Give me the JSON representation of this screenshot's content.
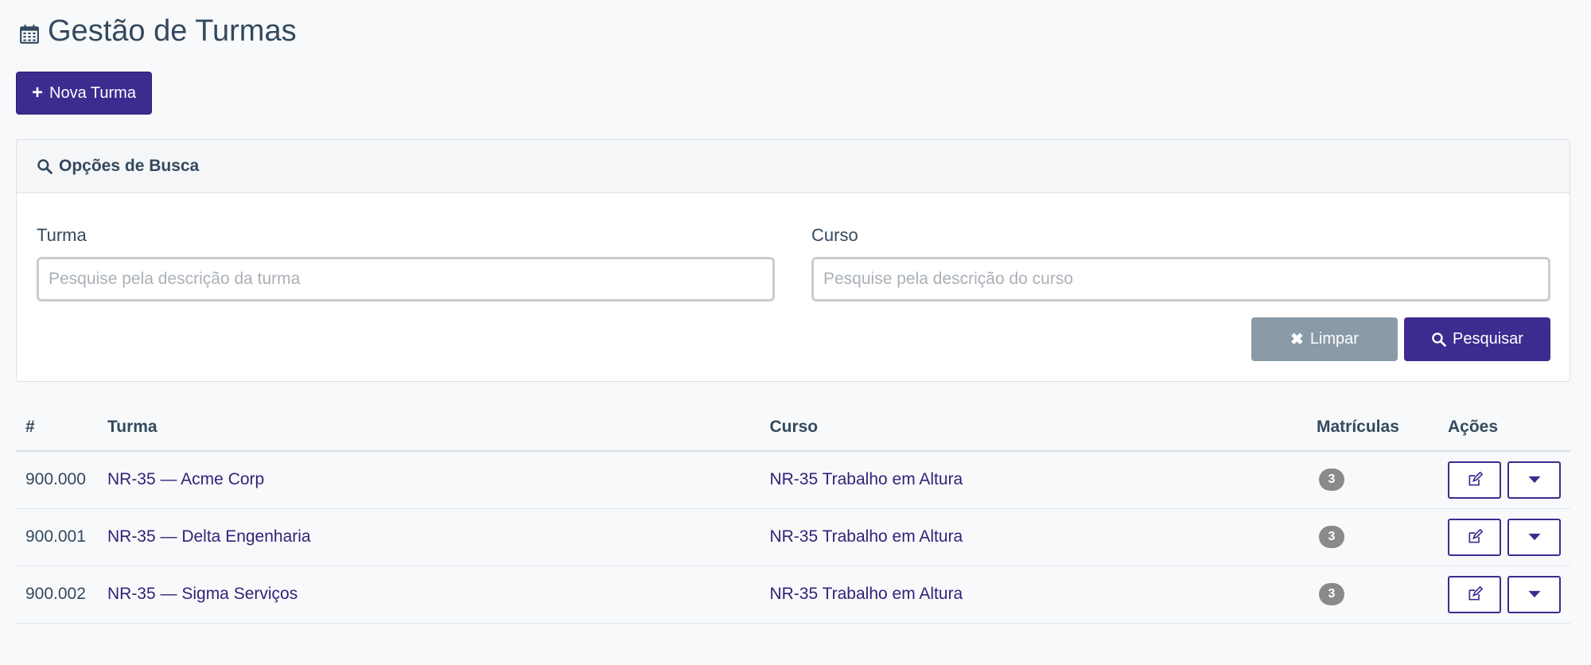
{
  "header": {
    "title": "Gestão de Turmas",
    "new_button": "Nova Turma"
  },
  "search": {
    "title": "Opções de Busca",
    "turma_label": "Turma",
    "turma_placeholder": "Pesquise pela descrição da turma",
    "curso_label": "Curso",
    "curso_placeholder": "Pesquise pela descrição do curso",
    "clear_label": "Limpar",
    "search_label": "Pesquisar"
  },
  "table": {
    "columns": [
      "#",
      "Turma",
      "Curso",
      "Matrículas",
      "Ações"
    ],
    "rows": [
      {
        "id": "900.000",
        "turma": "NR-35 — Acme Corp",
        "curso": "NR-35 Trabalho em Altura",
        "matriculas": "3"
      },
      {
        "id": "900.001",
        "turma": "NR-35 — Delta Engenharia",
        "curso": "NR-35 Trabalho em Altura",
        "matriculas": "3"
      },
      {
        "id": "900.002",
        "turma": "NR-35 — Sigma Serviços",
        "curso": "NR-35 Trabalho em Altura",
        "matriculas": "3"
      }
    ]
  },
  "colors": {
    "primary": "#3d2b8f",
    "secondary": "#8a9ba7",
    "badge": "#8a8a8a"
  }
}
